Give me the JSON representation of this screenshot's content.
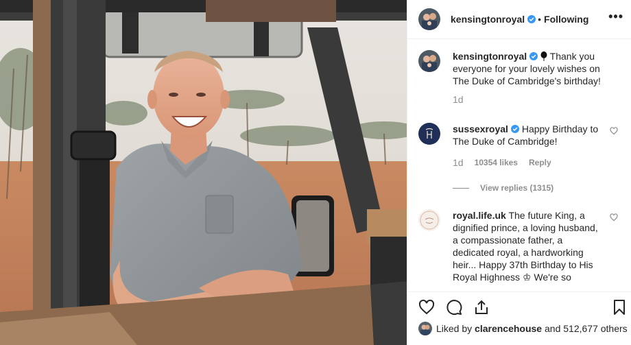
{
  "post": {
    "author": "kensingtonroyal",
    "follow_state": "Following",
    "separator": "•",
    "more_icon": "more-horizontal-icon"
  },
  "caption": {
    "username": "kensingtonroyal",
    "text": " Thank you everyone for your lovely wishes on The Duke of Cambridge's birthday!",
    "time": "1d"
  },
  "comments": [
    {
      "username": "sussexroyal",
      "text": " Happy Birthday to The Duke of Cambridge!",
      "time": "1d",
      "likes": "10354 likes",
      "reply": "Reply",
      "view_replies": "View replies (1315)"
    },
    {
      "username": "royal.life.uk",
      "text": " The future King, a dignified prince, a loving husband, a compassionate father, a dedicated royal, a hardworking heir... Happy 37th Birthday to His Royal Highness ♔ We're so"
    }
  ],
  "liked_by": {
    "prefix": "Liked by ",
    "user": "clarencehouse",
    "suffix": " and 512,677 others"
  },
  "colors": {
    "verified": "#3897f0",
    "text": "#262626",
    "muted": "#8e8e8e",
    "border": "#efefef"
  }
}
